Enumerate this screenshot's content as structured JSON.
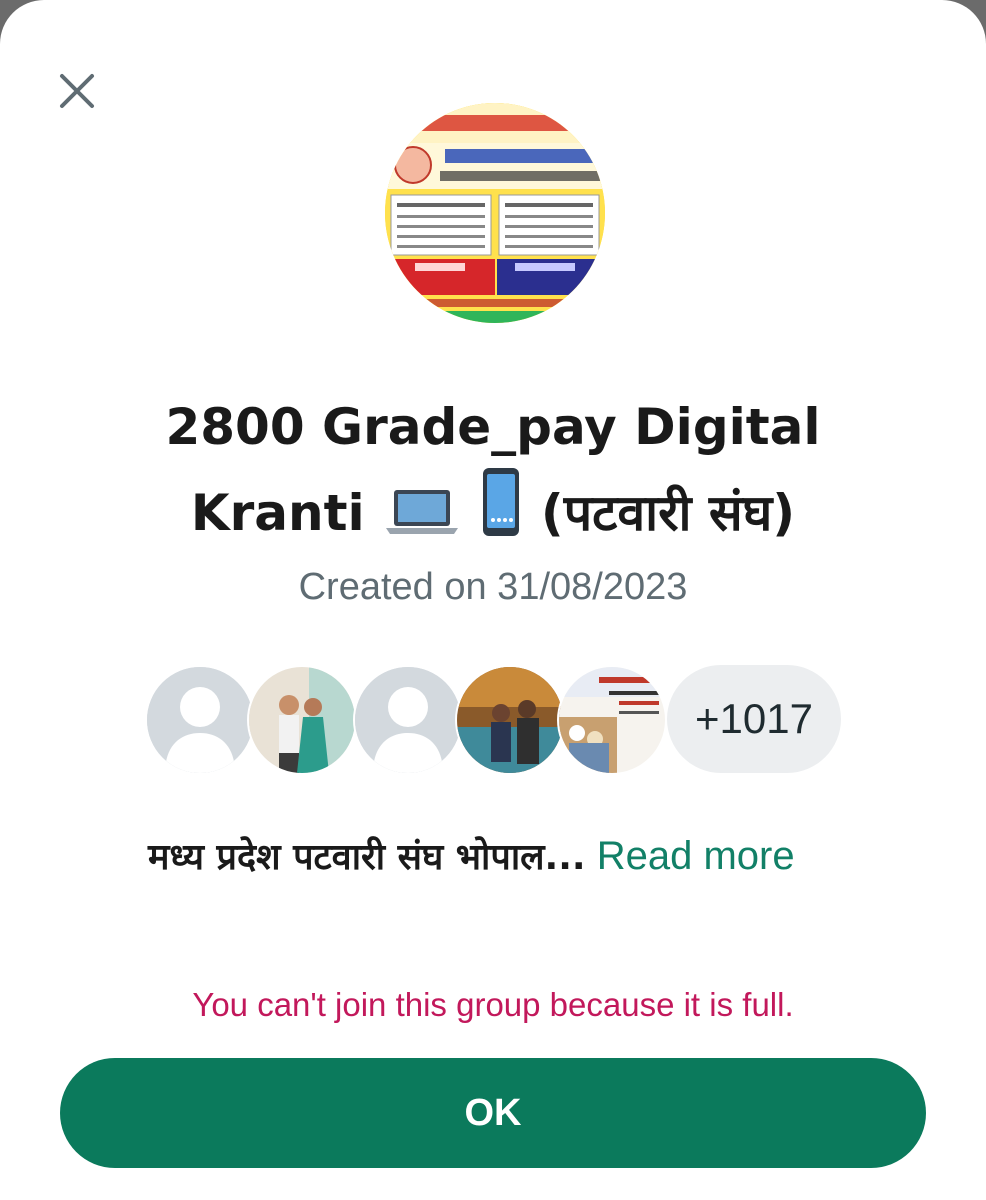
{
  "dialog": {
    "close_icon": "close-icon",
    "group_title_line1": "2800 Grade_pay Digital",
    "group_title_line2_text": "Kranti",
    "group_title_line2_suffix": "(पटवारी संघ)",
    "title_icons": [
      "laptop-icon",
      "mobile-phone-icon"
    ],
    "created_label": "Created on 31/08/2023",
    "members": {
      "avatars": [
        "default-avatar",
        "member-photo",
        "default-avatar",
        "member-photo",
        "member-photo"
      ],
      "more_count": "+1017"
    },
    "description": "मध्य प्रदेश पटवारी संघ भोपाल...",
    "read_more_label": "Read more",
    "error_message": "You can't join this group because it is full.",
    "ok_button": "OK",
    "colors": {
      "accent_green": "#0b7a5c",
      "link_green": "#128067",
      "error_red": "#c2185b",
      "muted_text": "#5f6c73"
    }
  }
}
